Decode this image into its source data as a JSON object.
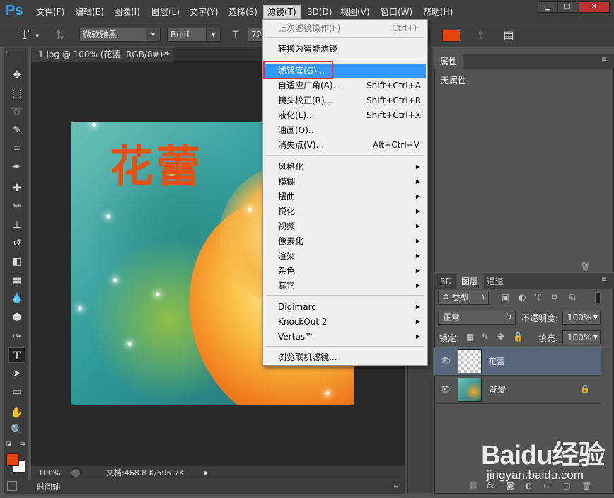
{
  "app": {
    "logo": "Ps"
  },
  "menubar": {
    "items": [
      "文件(F)",
      "编辑(E)",
      "图像(I)",
      "图层(L)",
      "文字(Y)",
      "选择(S)",
      "滤镜(T)",
      "3D(D)",
      "视图(V)",
      "窗口(W)",
      "帮助(H)"
    ],
    "active_index": 6
  },
  "window_controls": {
    "minimize": "▁",
    "maximize": "□",
    "close": "✕"
  },
  "options_bar": {
    "tool_icon": "T",
    "font_family": "微软雅黑",
    "font_style": "Bold",
    "font_size_icon": "T",
    "font_size": "72",
    "color_hex": "#e8450e"
  },
  "document": {
    "tab_title": "1.jpg @ 100% (花蕾, RGB/8#) *",
    "canvas_text": "花蕾"
  },
  "status": {
    "zoom": "100%",
    "doc_info": "文档:468.8 K/596.7K"
  },
  "timeline": {
    "label": "时间轴"
  },
  "properties_panel": {
    "tab": "属性",
    "content": "无属性"
  },
  "layers_panel": {
    "tabs": [
      "3D",
      "图层",
      "通道"
    ],
    "filter_kind": "类型",
    "blend_mode": "正常",
    "opacity_label": "不透明度:",
    "opacity_value": "100%",
    "lock_label": "锁定:",
    "fill_label": "填充:",
    "fill_value": "100%",
    "layers": [
      {
        "name": "花蕾",
        "selected": true,
        "thumb": "text-transparent"
      },
      {
        "name": "背景",
        "selected": false,
        "thumb": "image",
        "locked": true
      }
    ]
  },
  "filter_menu": {
    "items": [
      {
        "label": "上次滤镜操作(F)",
        "shortcut": "Ctrl+F",
        "disabled": true
      },
      {
        "label": "转换为智能滤镜"
      },
      {
        "label": "滤镜库(G)...",
        "highlighted": true
      },
      {
        "label": "自适应广角(A)...",
        "shortcut": "Shift+Ctrl+A"
      },
      {
        "label": "镜头校正(R)...",
        "shortcut": "Shift+Ctrl+R"
      },
      {
        "label": "液化(L)...",
        "shortcut": "Shift+Ctrl+X"
      },
      {
        "label": "油画(O)..."
      },
      {
        "label": "消失点(V)...",
        "shortcut": "Alt+Ctrl+V"
      },
      {
        "label": "风格化",
        "submenu": true
      },
      {
        "label": "模糊",
        "submenu": true
      },
      {
        "label": "扭曲",
        "submenu": true
      },
      {
        "label": "锐化",
        "submenu": true
      },
      {
        "label": "视频",
        "submenu": true
      },
      {
        "label": "像素化",
        "submenu": true
      },
      {
        "label": "渲染",
        "submenu": true
      },
      {
        "label": "杂色",
        "submenu": true
      },
      {
        "label": "其它",
        "submenu": true
      },
      {
        "label": "Digimarc",
        "submenu": true
      },
      {
        "label": "KnockOut 2",
        "submenu": true
      },
      {
        "label": "Vertus™",
        "submenu": true
      },
      {
        "label": "浏览联机滤镜..."
      }
    ]
  },
  "colors": {
    "foreground": "#e8450e",
    "background": "#ffffff",
    "menu_highlight": "#3399ff",
    "annotation_box": "#e8322e"
  },
  "watermark": {
    "brand": "Baidu经验",
    "url": "jingyan.baidu.com"
  }
}
